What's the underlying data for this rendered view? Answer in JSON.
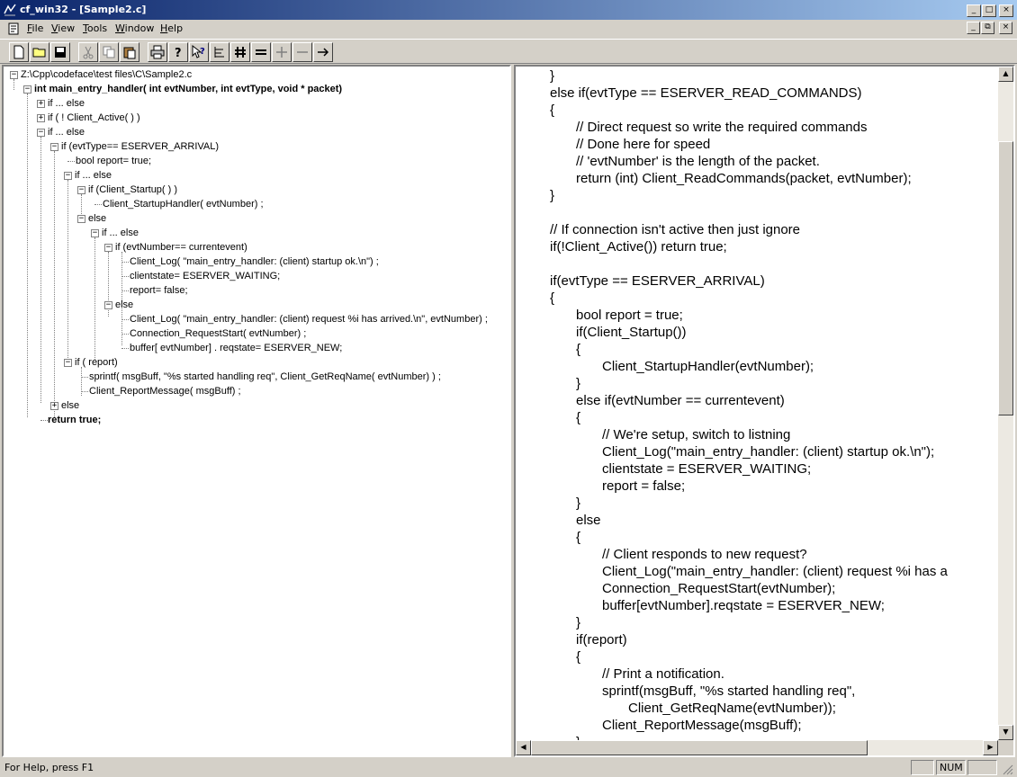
{
  "window": {
    "title": "cf_win32 - [Sample2.c]",
    "controls": [
      "_",
      "□",
      "×"
    ],
    "mdi_controls": [
      "_",
      "⧉",
      "×"
    ]
  },
  "menu": {
    "file": "File",
    "view": "View",
    "tools": "Tools",
    "window": "Window",
    "help": "Help"
  },
  "toolbar": {
    "icons": [
      "new-file-icon",
      "open-folder-icon",
      "save-icon",
      "cut-icon",
      "copy-icon",
      "paste-icon",
      "print-icon",
      "help-icon",
      "context-help-icon",
      "tree-icon",
      "hash-icon",
      "equals-icon",
      "plus-icon",
      "minus-icon",
      "arrow-right-icon"
    ]
  },
  "tree": {
    "root": "Z:\\Cpp\\codeface\\test files\\C\\Sample2.c",
    "items": [
      {
        "text": "int main_entry_handler( int evtNumber, int evtType, void * packet)",
        "bold": true
      },
      {
        "text": "if ... else"
      },
      {
        "text": "if ( ! Client_Active( ) )"
      },
      {
        "text": "if ... else"
      },
      {
        "text": "if (evtType== ESERVER_ARRIVAL)"
      },
      {
        "text": "bool report= true;"
      },
      {
        "text": "if ... else"
      },
      {
        "text": "if (Client_Startup( ) )"
      },
      {
        "text": "Client_StartupHandler( evtNumber) ;"
      },
      {
        "text": "else"
      },
      {
        "text": "if ... else"
      },
      {
        "text": "if (evtNumber== currentevent)"
      },
      {
        "text": "Client_Log( \"main_entry_handler: (client) startup ok.\\n\") ;"
      },
      {
        "text": "clientstate= ESERVER_WAITING;"
      },
      {
        "text": "report= false;"
      },
      {
        "text": "else"
      },
      {
        "text": "Client_Log( \"main_entry_handler: (client) request %i has arrived.\\n\", evtNumber) ;"
      },
      {
        "text": "Connection_RequestStart( evtNumber) ;"
      },
      {
        "text": "buffer[ evtNumber] . reqstate= ESERVER_NEW;"
      },
      {
        "text": "if ( report)"
      },
      {
        "text": "sprintf( msgBuff, \"%s started handling req\", Client_GetReqName( evtNumber) ) ;"
      },
      {
        "text": "Client_ReportMessage( msgBuff) ;"
      },
      {
        "text": "else"
      },
      {
        "text": "return true;",
        "bold": true
      }
    ]
  },
  "code": {
    "lines": [
      "}",
      "else if(evtType == ESERVER_READ_COMMANDS)",
      "{",
      "// Direct request so write the required commands",
      "// Done here for speed",
      "// 'evtNumber' is the length of the packet.",
      "return (int) Client_ReadCommands(packet, evtNumber);",
      "}",
      "",
      "// If connection isn't active then just ignore",
      "if(!Client_Active()) return true;",
      "",
      "if(evtType == ESERVER_ARRIVAL)",
      "{",
      "bool report = true;",
      "if(Client_Startup())",
      "{",
      "Client_StartupHandler(evtNumber);",
      "}",
      "else if(evtNumber == currentevent)",
      "{",
      "// We're setup, switch to listning",
      "Client_Log(\"main_entry_handler: (client) startup ok.\\n\");",
      "clientstate = ESERVER_WAITING;",
      "report = false;",
      "}",
      "else",
      "{",
      "// Client responds to new request?",
      "Client_Log(\"main_entry_handler: (client) request %i has a",
      "Connection_RequestStart(evtNumber);",
      "buffer[evtNumber].reqstate = ESERVER_NEW;",
      "}",
      "if(report)",
      "{",
      "// Print a notification.",
      "sprintf(msgBuff, \"%s started handling req\",",
      "Client_GetReqName(evtNumber));",
      "Client_ReportMessage(msgBuff);",
      "}"
    ]
  },
  "status": {
    "help_text": "For Help, press F1",
    "num": "NUM"
  }
}
